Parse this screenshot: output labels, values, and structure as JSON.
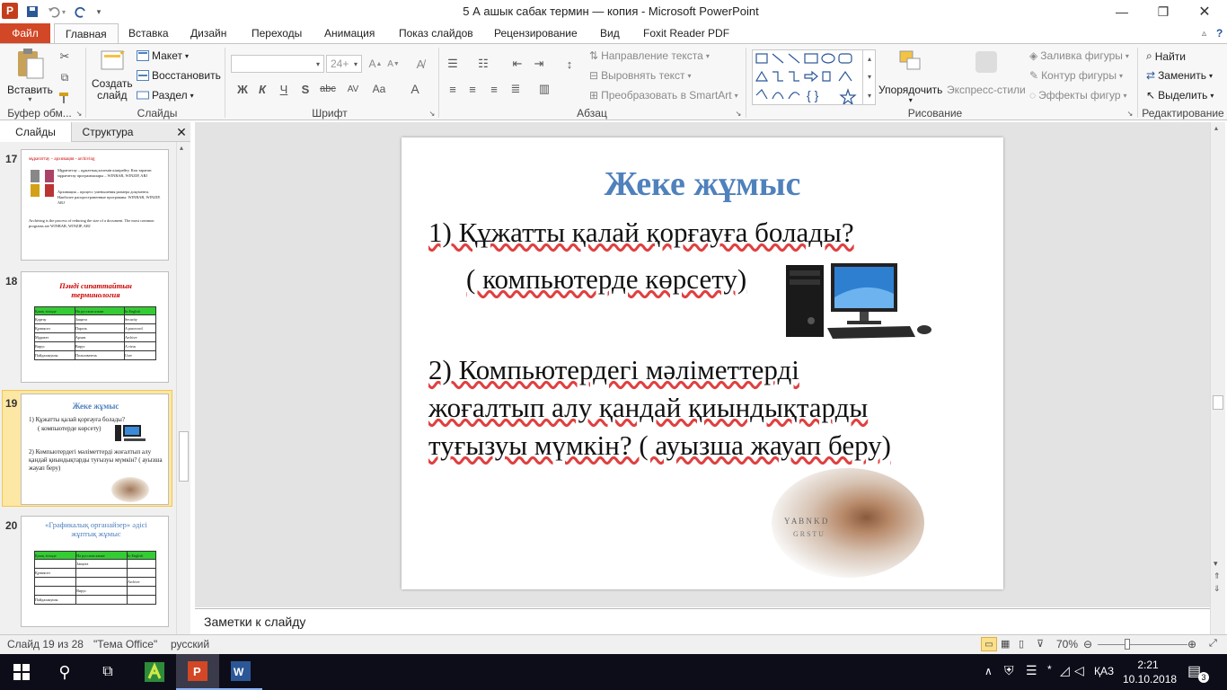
{
  "window": {
    "title": "5 А ашык сабак термин — копия  -  Microsoft PowerPoint"
  },
  "tabs": {
    "file": "Файл",
    "items": [
      "Главная",
      "Вставка",
      "Дизайн",
      "Переходы",
      "Анимация",
      "Показ слайдов",
      "Рецензирование",
      "Вид",
      "Foxit Reader PDF"
    ]
  },
  "ribbon": {
    "clipboard": {
      "paste": "Вставить",
      "label": "Буфер обм..."
    },
    "slides": {
      "new_slide_line1": "Создать",
      "new_slide_line2": "слайд",
      "layout": "Макет",
      "reset": "Восстановить",
      "section": "Раздел",
      "label": "Слайды"
    },
    "font": {
      "size": "24+",
      "label": "Шрифт",
      "bold": "Ж",
      "italic": "К",
      "underline": "Ч",
      "shadow": "S",
      "strike": "abc",
      "spacing": "AV",
      "case": "Aa"
    },
    "paragraph": {
      "text_direction": "Направление текста",
      "align_text": "Выровнять текст",
      "smartart": "Преобразовать в SmartArt",
      "label": "Абзац"
    },
    "drawing": {
      "arrange": "Упорядочить",
      "quick_styles": "Экспресс-стили",
      "shape_fill": "Заливка фигуры",
      "shape_outline": "Контур фигуры",
      "shape_effects": "Эффекты фигур",
      "label": "Рисование"
    },
    "editing": {
      "find": "Найти",
      "replace": "Заменить",
      "select": "Выделить",
      "label": "Редактирование"
    }
  },
  "panel": {
    "tab_slides": "Слайды",
    "tab_outline": "Структура"
  },
  "thumbnails": [
    {
      "num": "17",
      "lines": [
        "мұрағаттау – архивация - archiving",
        "Мұрағаттау – құжаттың көлемін кішірейту. Көп тараған мұрағаттау программалары – WINRAR, WINZIP, ARJ",
        "Архивация – процесс уменьшения размера документа. Наиболее распространенные программы: WINRAR, WINZIP, ARJ",
        "Archiving is the process of reducing the size of a document. The most common programs are WINRAR, WINZIP, ARJ"
      ]
    },
    {
      "num": "18",
      "title": "Пәнді сипаттайтын терминология",
      "headers": [
        "Қазақ тілінде",
        "На русском языке",
        "In English"
      ],
      "rows": [
        [
          "Қорғау",
          "Защита",
          "Security"
        ],
        [
          "Құпиясөз",
          "Пароль",
          "A password"
        ],
        [
          "Мұрағат",
          "Архив",
          "Archive"
        ],
        [
          "Вирус",
          "Вирус",
          "A virus"
        ],
        [
          "Пайдаланушы",
          "Пользователь",
          "User"
        ]
      ]
    },
    {
      "num": "19",
      "title": "Жеке жұмыс",
      "q1": "1)   Құжатты қалай қорғауға болады?",
      "q1b": "( компьютерде көрсету)",
      "q2": "2) Компьютердегі мәліметтерді жоғалтып алу қандай қиындықтарды туғызуы мүмкін? ( ауызша жауап беру)"
    },
    {
      "num": "20",
      "title": "«Графикалық органайзер» әдісі жұптық жұмыс",
      "headers": [
        "Қазақ тілінде",
        "На русском языке",
        "In English"
      ],
      "rows": [
        [
          "",
          "Защита",
          ""
        ],
        [
          "Құпиясөз",
          "",
          ""
        ],
        [
          "",
          "",
          "Archive"
        ],
        [
          "",
          "Вирус",
          ""
        ],
        [
          "Пайдаланушы",
          "",
          ""
        ]
      ]
    }
  ],
  "slide": {
    "title": "Жеке жұмыс",
    "q1": "1)   Құжатты қалай қорғауға болады?",
    "q1b": "( компьютерде көрсету)",
    "q2_line1": "2) Компьютердегі мәліметтерді",
    "q2_line2": "жоғалтып алу қандай қиындықтарды",
    "q2_line3": "туғызуы мүмкін? ( ауызша жауап беру)"
  },
  "notes": {
    "placeholder": "Заметки к слайду"
  },
  "status": {
    "slide_counter": "Слайд 19 из 28",
    "theme": "\"Тема Office\"",
    "language": "русский",
    "zoom": "70%"
  },
  "taskbar": {
    "lang": "ҚАЗ",
    "time": "2:21",
    "date": "10.10.2018",
    "notifications": "3"
  },
  "colors": {
    "accent": "#4f81bd",
    "file_tab": "#d24726",
    "taskbar": "#0d0d1a"
  }
}
